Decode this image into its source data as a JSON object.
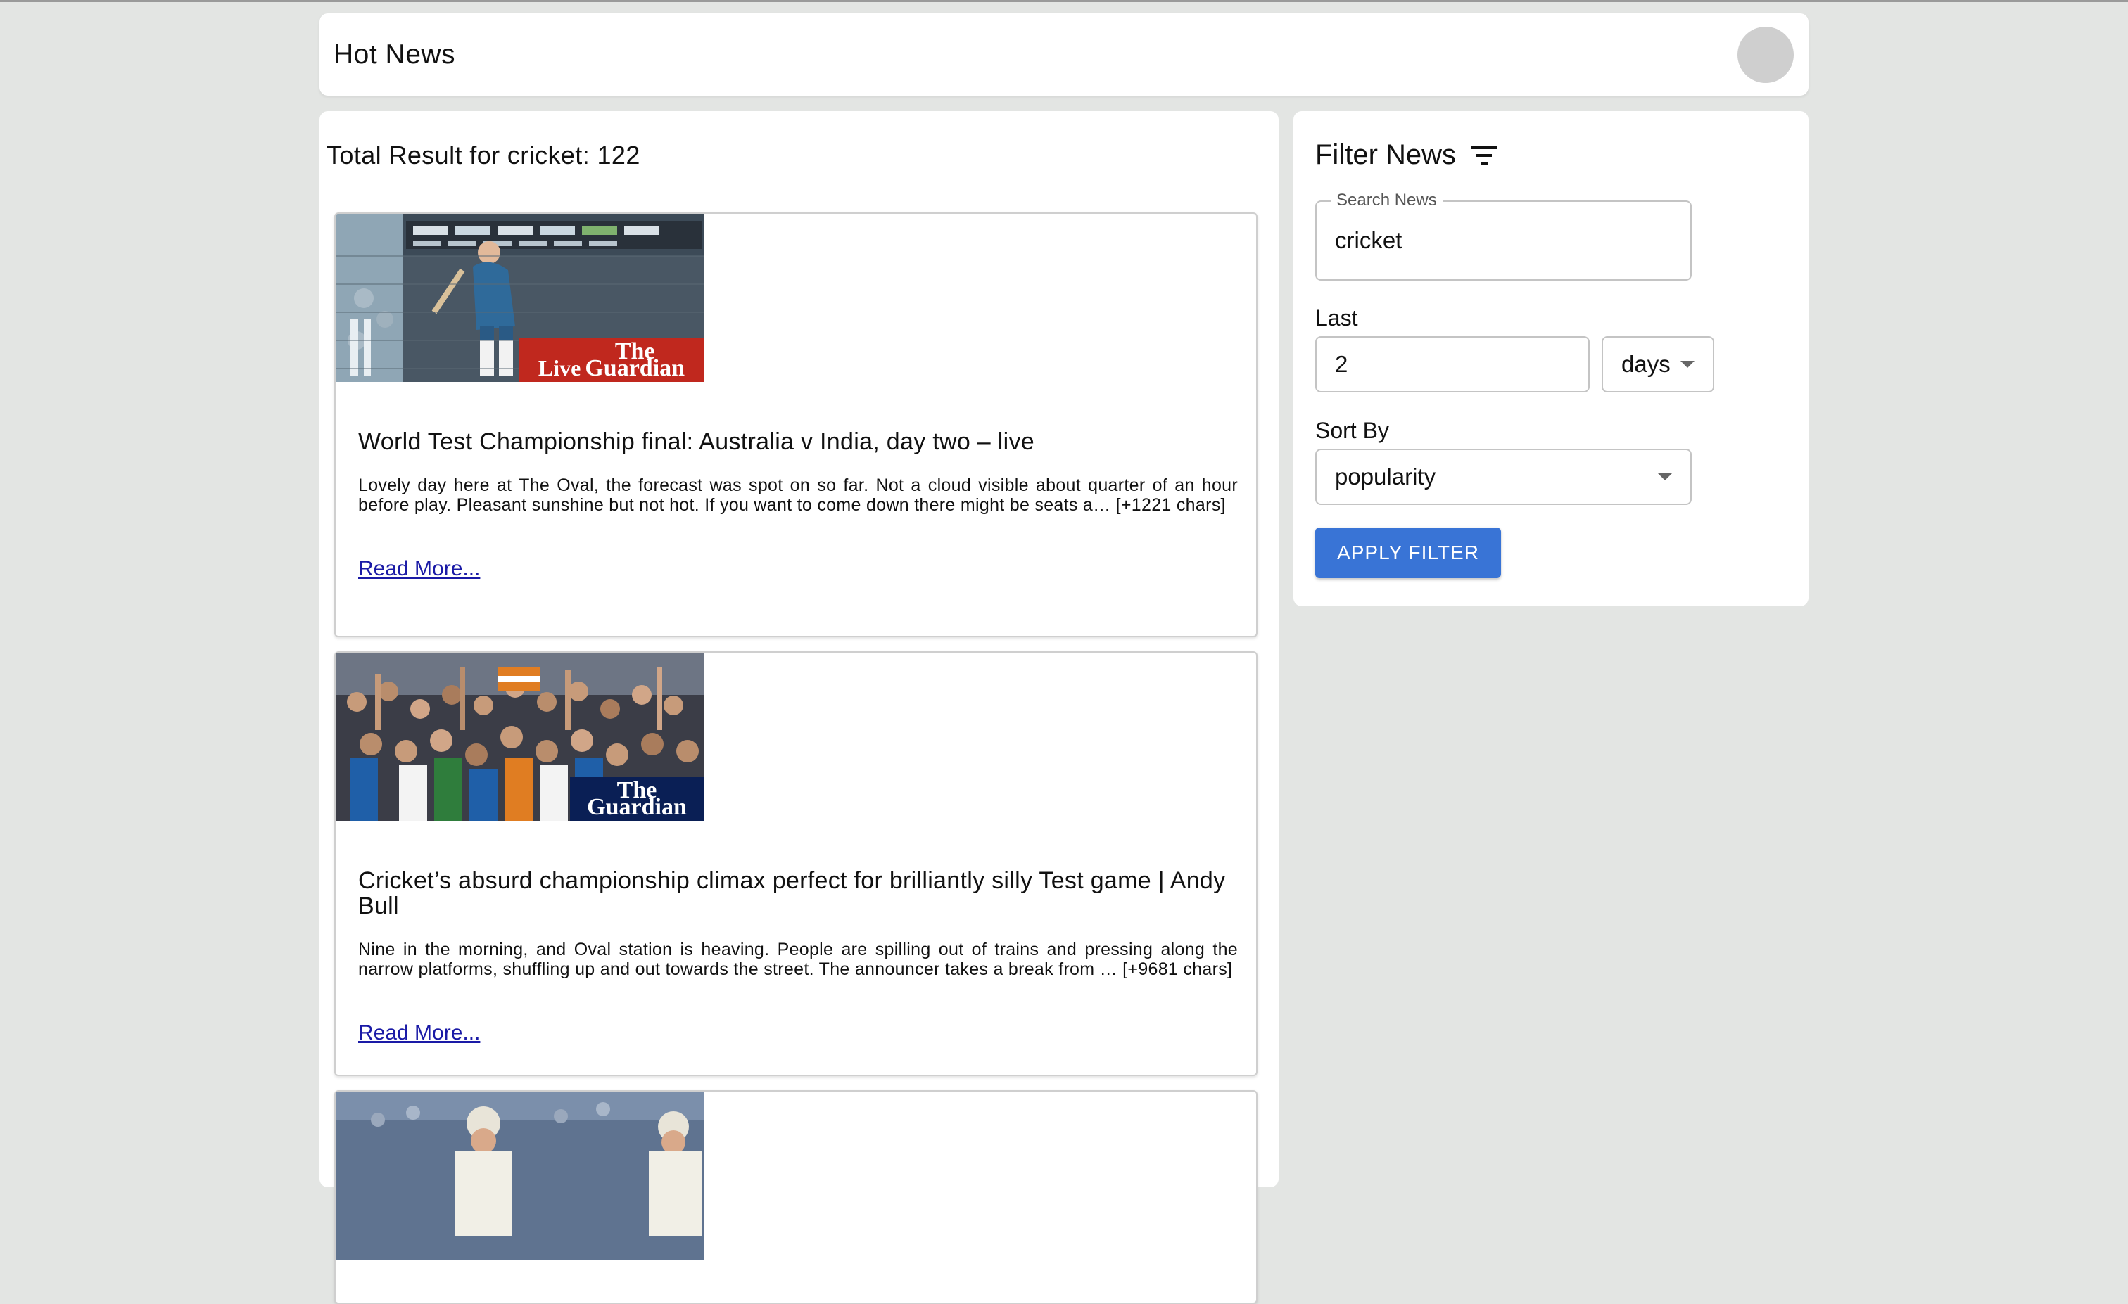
{
  "app": {
    "title": "Hot News"
  },
  "results": {
    "heading": "Total Result for cricket: 122",
    "articles": [
      {
        "title": "World Test Championship final: Australia v India, day two – live",
        "description": "Lovely day here at The Oval, the forecast was spot on so far. Not a cloud visible about quarter of an hour before play. Pleasant sunshine but not hot. If you want to come down there might be seats a… [+1221 chars]",
        "read_more": "Read More...",
        "image_badge": {
          "prefix": "Live",
          "line1": "The",
          "line2": "Guardian"
        }
      },
      {
        "title": "Cricket’s absurd championship climax perfect for brilliantly silly Test game | Andy Bull",
        "description": "Nine in the morning, and Oval station is heaving. People are spilling out of trains and pressing along the narrow platforms, shuffling up and out towards the street. The announcer takes a break from … [+9681 chars]",
        "read_more": "Read More...",
        "image_badge": {
          "line1": "The",
          "line2": "Guardian"
        }
      }
    ]
  },
  "filter": {
    "title": "Filter News",
    "search": {
      "legend": "Search News",
      "value": "cricket"
    },
    "last": {
      "label": "Last",
      "value": "2",
      "unit": "days"
    },
    "sort": {
      "label": "Sort By",
      "value": "popularity"
    },
    "apply_label": "APPLY FILTER"
  },
  "colors": {
    "background": "#e3e5e3",
    "accent": "#3974d6",
    "link": "#1a1aa6",
    "guardian_red": "#c0281e",
    "guardian_blue": "#0a1f55"
  }
}
